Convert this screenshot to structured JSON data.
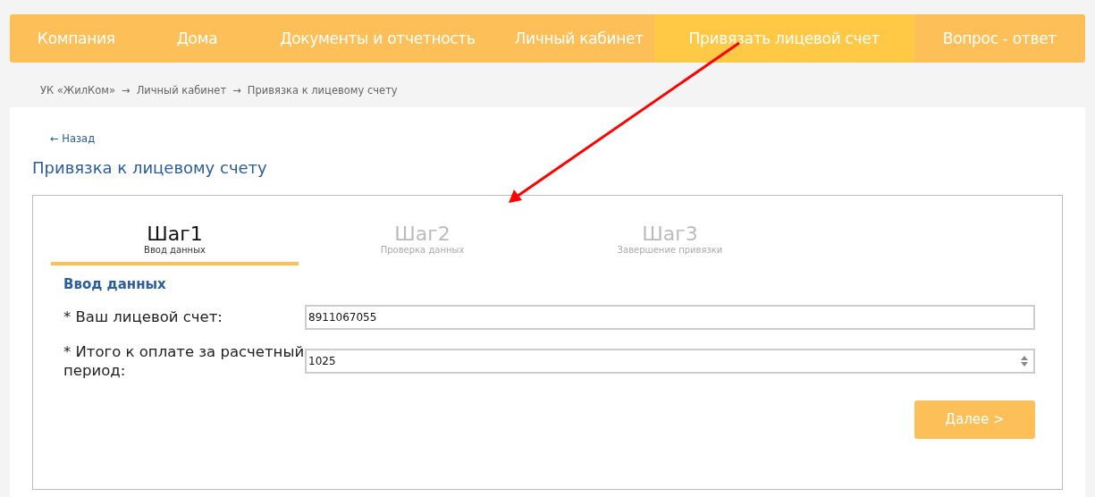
{
  "nav": [
    {
      "label": "Компания",
      "selected": false
    },
    {
      "label": "Дома",
      "selected": false
    },
    {
      "label": "Документы и отчетность",
      "selected": false
    },
    {
      "label": "Личный кабинет",
      "selected": false
    },
    {
      "label": "Привязать лицевой счет",
      "selected": true
    },
    {
      "label": "Вопрос - ответ",
      "selected": false
    }
  ],
  "breadcrumb": [
    "УК «ЖилКом»",
    "→",
    "Личный кабинет",
    "→",
    "Привязка к лицевому счету"
  ],
  "back_link": "← Назад",
  "heading": "Привязка к лицевому счету",
  "steps": [
    {
      "title": "Шаг1",
      "subtitle": "Ввод данных",
      "selected": true
    },
    {
      "title": "Шаг2",
      "subtitle": "Проверка данных",
      "selected": false
    },
    {
      "title": "Шаг3",
      "subtitle": "Завершение привязки",
      "selected": false
    }
  ],
  "section_title": "Ввод данных",
  "fields": [
    {
      "label": "* Ваш лицевой счет:",
      "value": "8911067055",
      "kind": "text"
    },
    {
      "label": "* Итого к оплате за расчетный период:",
      "value": "1025",
      "kind": "number"
    }
  ],
  "next_button": "Далее >"
}
